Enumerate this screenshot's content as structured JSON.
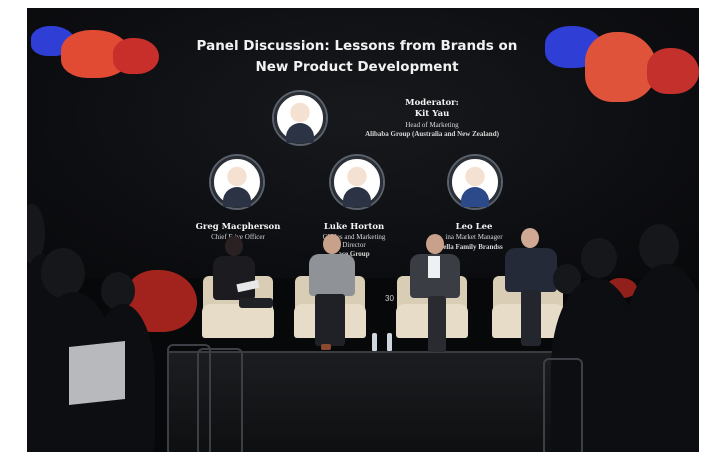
{
  "screen": {
    "title_line1": "Panel Discussion: Lessons from Brands on",
    "title_line2": "New Product Development"
  },
  "moderator": {
    "label": "Moderator:",
    "name": "Kit Yau",
    "role": "Head of Marketing",
    "org": "Alibaba Group (Australia and New Zealand)"
  },
  "panelists": [
    {
      "name": "Greg Macpherson",
      "role": "Chief E    ive Officer",
      "org": ""
    },
    {
      "name": "Luke Horton",
      "role": "Glo    les and Marketing",
      "role2": "Director",
      "org": "   ace Group"
    },
    {
      "name": "Leo Lee",
      "role": "ina Market Manager",
      "org": "ella Family Brandss"
    }
  ],
  "stage_number": "30",
  "colors": {
    "screen_bg": "#0c0d10",
    "blob_red": "#e0432f",
    "blob_blue": "#2f3fd6",
    "chair": "#e6dcc8"
  }
}
